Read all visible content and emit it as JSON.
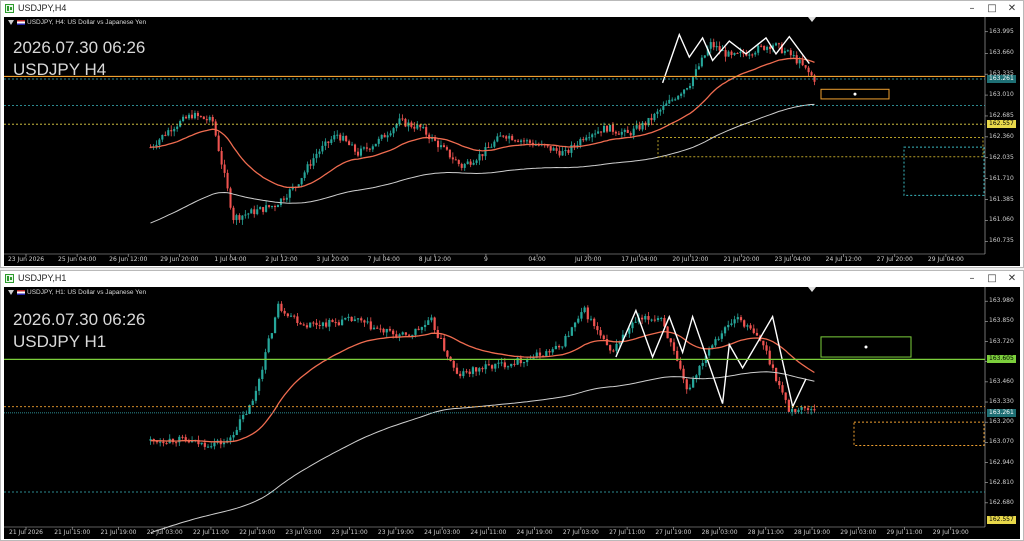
{
  "window1": {
    "title": "USDJPY,H4",
    "symbol_desc": "USDJPY, H4:  US Dollar vs Japanese Yen",
    "datetime": "2026.07.30 06:26",
    "symbol_tf": "USDJPY H4",
    "price_axis": [
      "163.995",
      "163.660",
      "163.335",
      "163.010",
      "162.685",
      "162.360",
      "162.035",
      "161.710",
      "161.385",
      "161.060",
      "160.735"
    ],
    "current_price": "163.261",
    "level_price": "162.557",
    "time_axis": [
      "23 Jun 2026",
      "25 Jun 04:00",
      "26 Jun 12:00",
      "29 Jun 20:00",
      "1 Jul 04:00",
      "2 Jul 12:00",
      "3 Jul 20:00",
      "7 Jul 04:00",
      "8 Jul 12:00",
      "9",
      "04:00",
      "Jul 20:00",
      "17 Jul 04:00",
      "20 Jul 12:00",
      "21 Jul 20:00",
      "23 Jul 04:00",
      "24 Jul 12:00",
      "27 Jul 20:00",
      "29 Jul 04:00"
    ]
  },
  "window2": {
    "title": "USDJPY,H1",
    "symbol_desc": "USDJPY, H1:  US Dollar vs Japanese Yen",
    "datetime": "2026.07.30 06:26",
    "symbol_tf": "USDJPY H1",
    "price_axis": [
      "163.980",
      "163.850",
      "163.720",
      "163.590",
      "163.460",
      "163.330",
      "163.200",
      "163.070",
      "162.940",
      "162.810",
      "162.680"
    ],
    "current_price": "163.261",
    "level_price": "163.605",
    "bottom_price": "162.557",
    "time_axis": [
      "21 Jul 2026",
      "21 Jul 15:00",
      "21 Jul 19:00",
      "22 Jul 03:00",
      "22 Jul 11:00",
      "22 Jul 19:00",
      "23 Jul 03:00",
      "23 Jul 11:00",
      "23 Jul 19:00",
      "24 Jul 03:00",
      "24 Jul 11:00",
      "24 Jul 19:00",
      "27 Jul 03:00",
      "27 Jul 11:00",
      "27 Jul 19:00",
      "28 Jul 03:00",
      "28 Jul 11:00",
      "28 Jul 19:00",
      "29 Jul 03:00",
      "29 Jul 11:00",
      "29 Jul 19:00"
    ]
  },
  "colors": {
    "bull": "#26a69a",
    "bear": "#ef5350",
    "ma_fast": "#ef6c50",
    "ma_slow": "#cfcfcf",
    "zigzag": "#ffffff",
    "level_green": "#7ccf3c",
    "level_orange": "#f0a030",
    "level_cyan": "#3ab8c0",
    "grid": "#1a1a1a"
  },
  "icons": {
    "window_icon": "chart-window-icon",
    "minimize": "minimize-icon",
    "maximize": "maximize-icon",
    "close": "close-icon"
  },
  "chart_data": [
    {
      "type": "candlestick",
      "title": "USDJPY, H4",
      "ylim": [
        160.6,
        164.1
      ],
      "series": [
        {
          "name": "USDJPY",
          "close": [
            162.2,
            162.5,
            162.7,
            162.6,
            161.1,
            161.2,
            161.3,
            161.6,
            162.1,
            162.4,
            162.1,
            162.3,
            162.6,
            162.5,
            162.2,
            161.9,
            162.1,
            162.4,
            162.3,
            162.2,
            162.1,
            162.4,
            162.5,
            162.4,
            162.6,
            162.9,
            163.2,
            163.8,
            163.6,
            163.7,
            163.8,
            163.6,
            163.26
          ]
        }
      ],
      "ma_fast": "red moving average",
      "ma_slow": "white moving average"
    },
    {
      "type": "candlestick",
      "title": "USDJPY, H1",
      "ylim": [
        162.55,
        164.02
      ],
      "series": [
        {
          "name": "USDJPY",
          "close": [
            163.08,
            163.09,
            163.06,
            163.07,
            163.33,
            163.95,
            163.83,
            163.84,
            163.86,
            163.79,
            163.75,
            163.85,
            163.5,
            163.55,
            163.58,
            163.62,
            163.68,
            163.92,
            163.65,
            163.85,
            163.88,
            163.4,
            163.72,
            163.88,
            163.7,
            163.28,
            163.29
          ]
        }
      ],
      "ma_fast": "red moving average",
      "ma_slow": "white moving average"
    }
  ]
}
